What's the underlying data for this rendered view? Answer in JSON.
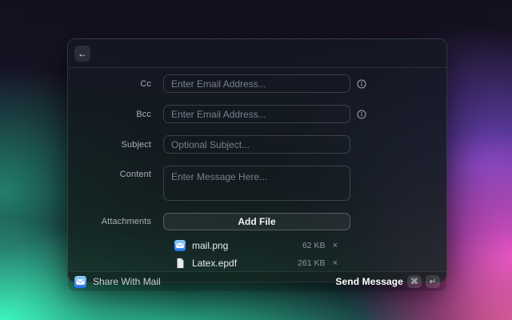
{
  "window": {
    "header": {},
    "form": {
      "fields": [
        {
          "label": "Cc",
          "placeholder": "Enter Email Address...",
          "type": "input",
          "info": true
        },
        {
          "label": "Bcc",
          "placeholder": "Enter Email Address...",
          "type": "input",
          "info": true
        },
        {
          "label": "Subject",
          "placeholder": "Optional Subject...",
          "type": "input",
          "info": false
        },
        {
          "label": "Content",
          "placeholder": "Enter Message Here...",
          "type": "textarea",
          "info": false
        }
      ],
      "attachments_field": {
        "label": "Attachments",
        "button_label": "Add File"
      }
    },
    "attachments": [
      {
        "icon": "mail-app-icon",
        "name": "mail.png",
        "size": "62 KB"
      },
      {
        "icon": "document-icon",
        "name": "Latex.epdf",
        "size": "261 KB"
      }
    ],
    "footer": {
      "app_icon": "mail-app-icon",
      "app_name": "Share With Mail",
      "action_label": "Send Message",
      "shortcut_keys": [
        "⌘",
        "↵"
      ]
    }
  },
  "icons": {
    "back": "←",
    "remove": "×"
  },
  "colors": {
    "mail_icon_blue_top": "#8ed2ff",
    "mail_icon_blue_bottom": "#1d6ce8",
    "accent_mint": "#3fffc4",
    "accent_magenta": "#e351c9",
    "accent_purple": "#7a4cd3"
  }
}
